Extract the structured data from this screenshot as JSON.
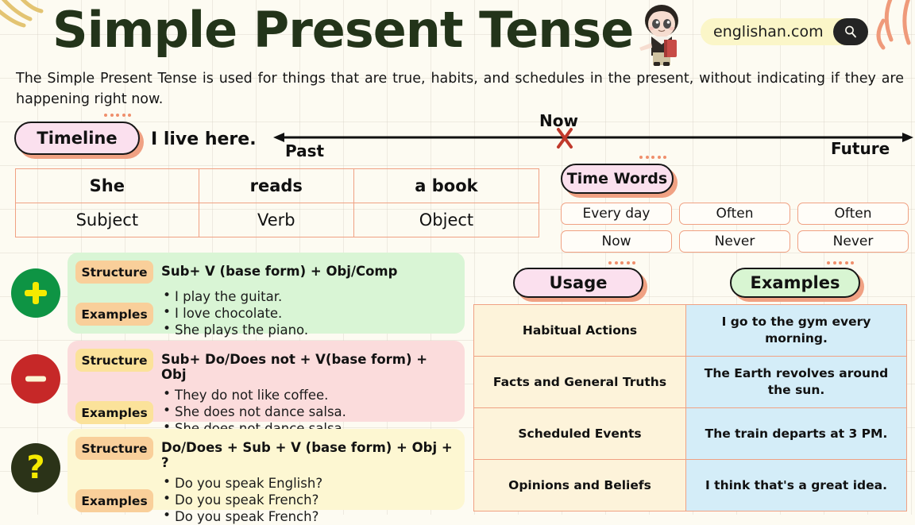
{
  "header": {
    "title": "Simple Present Tense",
    "brand": "englishan.com",
    "search_icon": "search-icon",
    "mascot": "student-mascot"
  },
  "subtitle": "The Simple Present Tense is used for things that are true, habits, and schedules in the present, without indicating if they are happening right now.",
  "timeline": {
    "pill_label": "Timeline",
    "sentence": "I live here.",
    "past_label": "Past",
    "now_label": "Now",
    "future_label": "Future",
    "marker": "X",
    "marker_color": "#c0392b"
  },
  "svo_table": {
    "examples": [
      "She",
      "reads",
      "a book"
    ],
    "roles": [
      "Subject",
      "Verb",
      "Object"
    ]
  },
  "time_words": {
    "pill_label": "Time Words",
    "rows": [
      [
        "Every day",
        "Often",
        "Often"
      ],
      [
        "Now",
        "Never",
        "Never"
      ]
    ]
  },
  "forms": [
    {
      "sign": "+",
      "sign_name": "plus-icon",
      "circle_color": "#0e9444",
      "sign_color": "#f5ea00",
      "panel_color": "#d9f5d5",
      "badge_color": "#f9cf9a",
      "structure_label": "Structure",
      "examples_label": "Examples",
      "structure": "Sub+ V (base form) + Obj/Comp",
      "examples": [
        "I play the guitar.",
        "I love chocolate.",
        "She plays the piano."
      ]
    },
    {
      "sign": "–",
      "sign_name": "minus-icon",
      "circle_color": "#c62828",
      "sign_color": "#fbf6d4",
      "panel_color": "#fbdcdc",
      "badge_color": "#fbe29a",
      "structure_label": "Structure",
      "examples_label": "Examples",
      "structure": "Sub+ Do/Does not + V(base form) + Obj",
      "examples": [
        "They do not like coffee.",
        "She does not dance salsa.",
        "She does not dance salsa."
      ]
    },
    {
      "sign": "?",
      "sign_name": "question-mark-icon",
      "circle_color": "#2b3318",
      "sign_color": "#f5ea00",
      "panel_color": "#fdf7d2",
      "badge_color": "#f9cf9a",
      "structure_label": "Structure",
      "examples_label": "Examples",
      "structure": "Do/Does + Sub + V (base form) + Obj + ?",
      "examples": [
        "Do you speak English?",
        "Do you speak French?",
        "Do you speak French?"
      ]
    }
  ],
  "usage_section": {
    "usage_pill": "Usage",
    "examples_pill": "Examples",
    "rows": [
      {
        "usage": "Habitual Actions",
        "example": "I go to the gym every morning."
      },
      {
        "usage": "Facts and General Truths",
        "example": "The Earth revolves around the sun."
      },
      {
        "usage": "Scheduled Events",
        "example": "The train departs at 3 PM."
      },
      {
        "usage": "Opinions and Beliefs",
        "example": "I think that's a great idea."
      }
    ]
  },
  "colors": {
    "background": "#fdfbf2",
    "title": "#23341a",
    "accent_salmon": "#f0a183",
    "pill_pink": "#fbe0ee",
    "pill_green": "#d8f5d2",
    "table_left": "#fdf3da",
    "table_right": "#d4edf8"
  }
}
